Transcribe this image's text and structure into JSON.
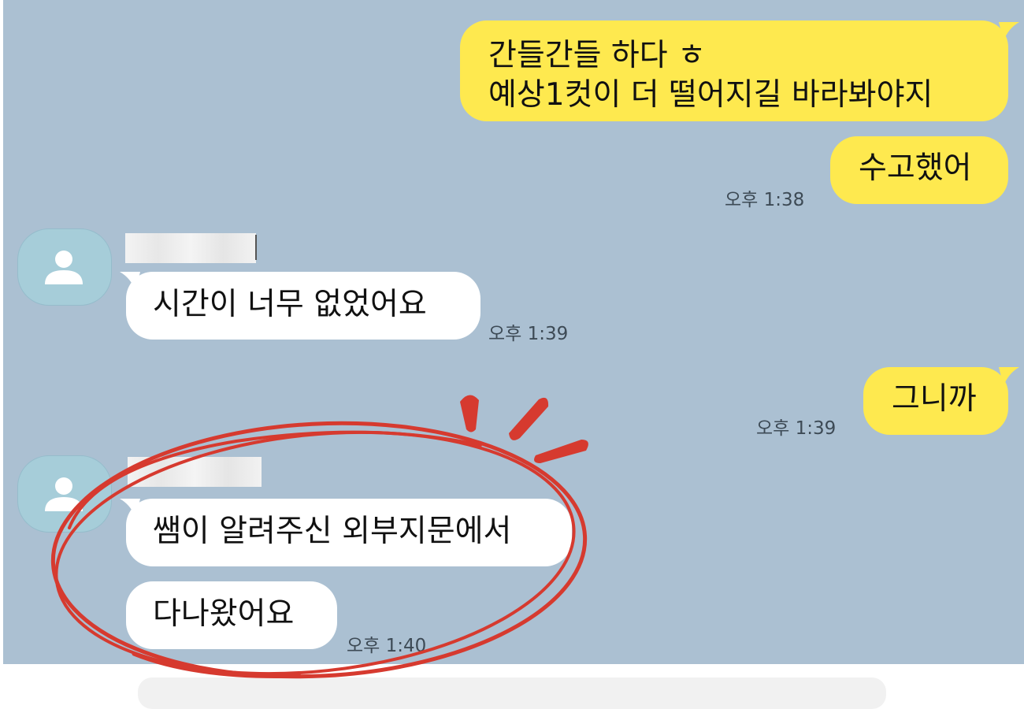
{
  "messages": [
    {
      "id": "m1",
      "side": "me",
      "lines": [
        "간들간들 하다 ㅎ",
        "예상1컷이 더 떨어지길 바라봐야지"
      ]
    },
    {
      "id": "m2",
      "side": "me",
      "text": "수고했어",
      "time": "오후 1:38"
    },
    {
      "id": "m3",
      "side": "them",
      "text": "시간이 너무 없었어요",
      "time": "오후 1:39"
    },
    {
      "id": "m4",
      "side": "me",
      "text": "그니까",
      "time": "오후 1:39"
    },
    {
      "id": "m5",
      "side": "them",
      "text": "쌤이 알려주신 외부지문에서"
    },
    {
      "id": "m6",
      "side": "them",
      "text": "다나왔어요",
      "time": "오후 1:40"
    }
  ],
  "colors": {
    "chat_background": "#abc0d2",
    "my_bubble": "#fee94f",
    "their_bubble": "#ffffff",
    "highlight_annotation": "#d63a2f"
  },
  "icons": {
    "avatar": "default-user-silhouette-icon"
  }
}
